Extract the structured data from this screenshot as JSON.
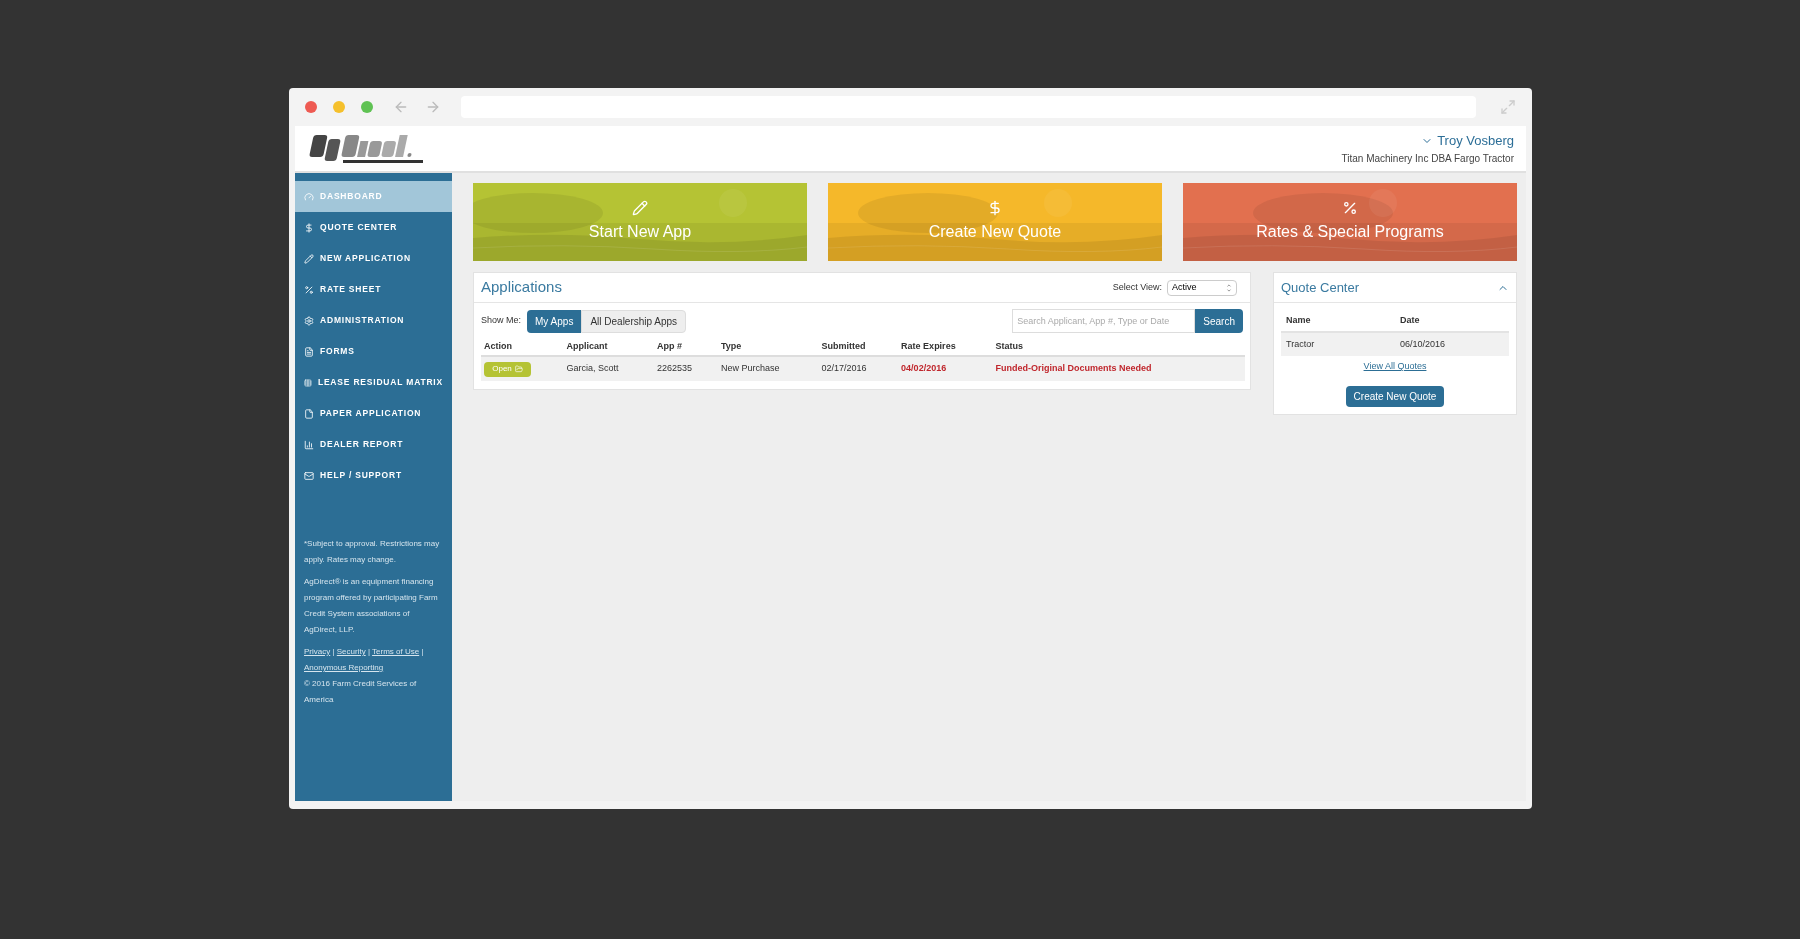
{
  "user": {
    "name": "Troy Vosberg",
    "company": "Titan Machinery Inc DBA Fargo Tractor"
  },
  "sidebar": {
    "items": [
      {
        "label": "DASHBOARD",
        "selected": true
      },
      {
        "label": "QUOTE CENTER",
        "selected": false
      },
      {
        "label": "NEW APPLICATION",
        "selected": false
      },
      {
        "label": "RATE SHEET",
        "selected": false
      },
      {
        "label": "ADMINISTRATION",
        "selected": false
      },
      {
        "label": "FORMS",
        "selected": false
      },
      {
        "label": "LEASE RESIDUAL MATRIX",
        "selected": false
      },
      {
        "label": "PAPER APPLICATION",
        "selected": false
      },
      {
        "label": "DEALER REPORT",
        "selected": false
      },
      {
        "label": "HELP / SUPPORT",
        "selected": false
      }
    ],
    "notes": [
      "*Subject to approval. Restrictions may apply. Rates may change.",
      "AgDirect® is an equipment financing program offered by participating Farm Credit System associations of AgDirect, LLP."
    ],
    "links": [
      "Privacy",
      "Security",
      "Terms of Use",
      "Anonymous Reporting"
    ],
    "separator": "|",
    "copyright": "© 2016 Farm Credit Services of America"
  },
  "tiles": [
    {
      "label": "Start New App",
      "color": "#b5c334"
    },
    {
      "label": "Create New Quote",
      "color": "#f5b82a"
    },
    {
      "label": "Rates & Special Programs",
      "color": "#e2704f"
    }
  ],
  "applications": {
    "title": "Applications",
    "select_label": "Select View:",
    "select_value": "Active",
    "show_me": "Show Me:",
    "toggles": [
      {
        "label": "My Apps",
        "selected": true
      },
      {
        "label": "All Dealership Apps",
        "selected": false
      }
    ],
    "search": {
      "placeholder": "Search Applicant, App #, Type or Date",
      "button": "Search"
    },
    "columns": [
      "Action",
      "Applicant",
      "App #",
      "Type",
      "Submitted",
      "Rate Expires",
      "Status"
    ],
    "rows": [
      {
        "action": "Open",
        "applicant": "Garcia, Scott",
        "app": "2262535",
        "type": "New Purchase",
        "submitted": "02/17/2016",
        "rate_expires": "04/02/2016",
        "status": "Funded-Original Documents Needed"
      }
    ]
  },
  "quote_center": {
    "title": "Quote Center",
    "expanded": true,
    "columns": [
      "Name",
      "Date"
    ],
    "rows": [
      {
        "name": "Tractor",
        "date": "06/10/2016"
      }
    ],
    "link": "View All Quotes",
    "button": "Create New Quote"
  }
}
